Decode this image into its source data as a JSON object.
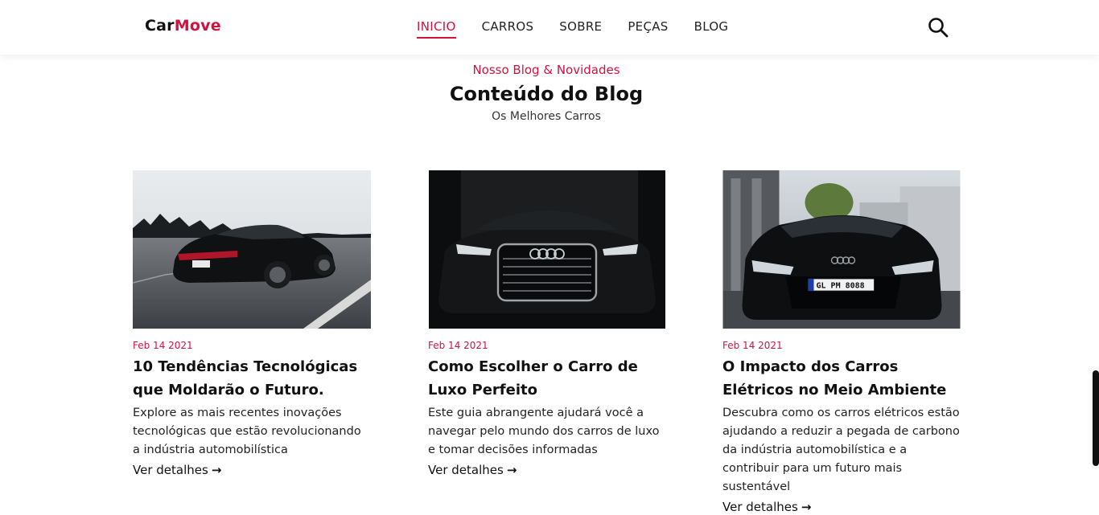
{
  "header": {
    "logo_main": "Car",
    "logo_accent": "Move",
    "nav": [
      {
        "label": "INICIO",
        "active": true
      },
      {
        "label": "CARROS",
        "active": false
      },
      {
        "label": "SOBRE",
        "active": false
      },
      {
        "label": "PEÇAS",
        "active": false
      },
      {
        "label": "BLOG",
        "active": false
      }
    ],
    "search_icon": "search-icon"
  },
  "section": {
    "eyebrow": "Nosso Blog & Novidades",
    "title": "Conteúdo do Blog",
    "subtitle": "Os Melhores Carros"
  },
  "cards": [
    {
      "date": "Feb 14 2021",
      "title": "10 Tendências Tecnológicas que Moldarão o Futuro.",
      "description": "Explore as mais recentes inovações tecnológicas que estão revolucionando a indústria automobilística",
      "link": "Ver detalhes",
      "image": "porsche-panamera-on-road"
    },
    {
      "date": "Feb 14 2021",
      "title": "Como Escolher o Carro de Luxo Perfeito",
      "description": "Este guia abrangente ajudará você a navegar pelo mundo dos carros de luxo e tomar decisões informadas",
      "link": "Ver detalhes",
      "image": "audi-a8-front"
    },
    {
      "date": "Feb 14 2021",
      "title": "O Impacto dos Carros Elétricos no Meio Ambiente",
      "description": "Descubra como os carros elétricos estão ajudando a reduzir a pegada de carbono da indústria automobilística e a contribuir para um futuro mais sustentável",
      "link": "Ver detalhes",
      "image": "audi-r8-street",
      "plate": "GL PM 8088"
    }
  ],
  "colors": {
    "accent": "#d1123f",
    "text": "#111111"
  }
}
